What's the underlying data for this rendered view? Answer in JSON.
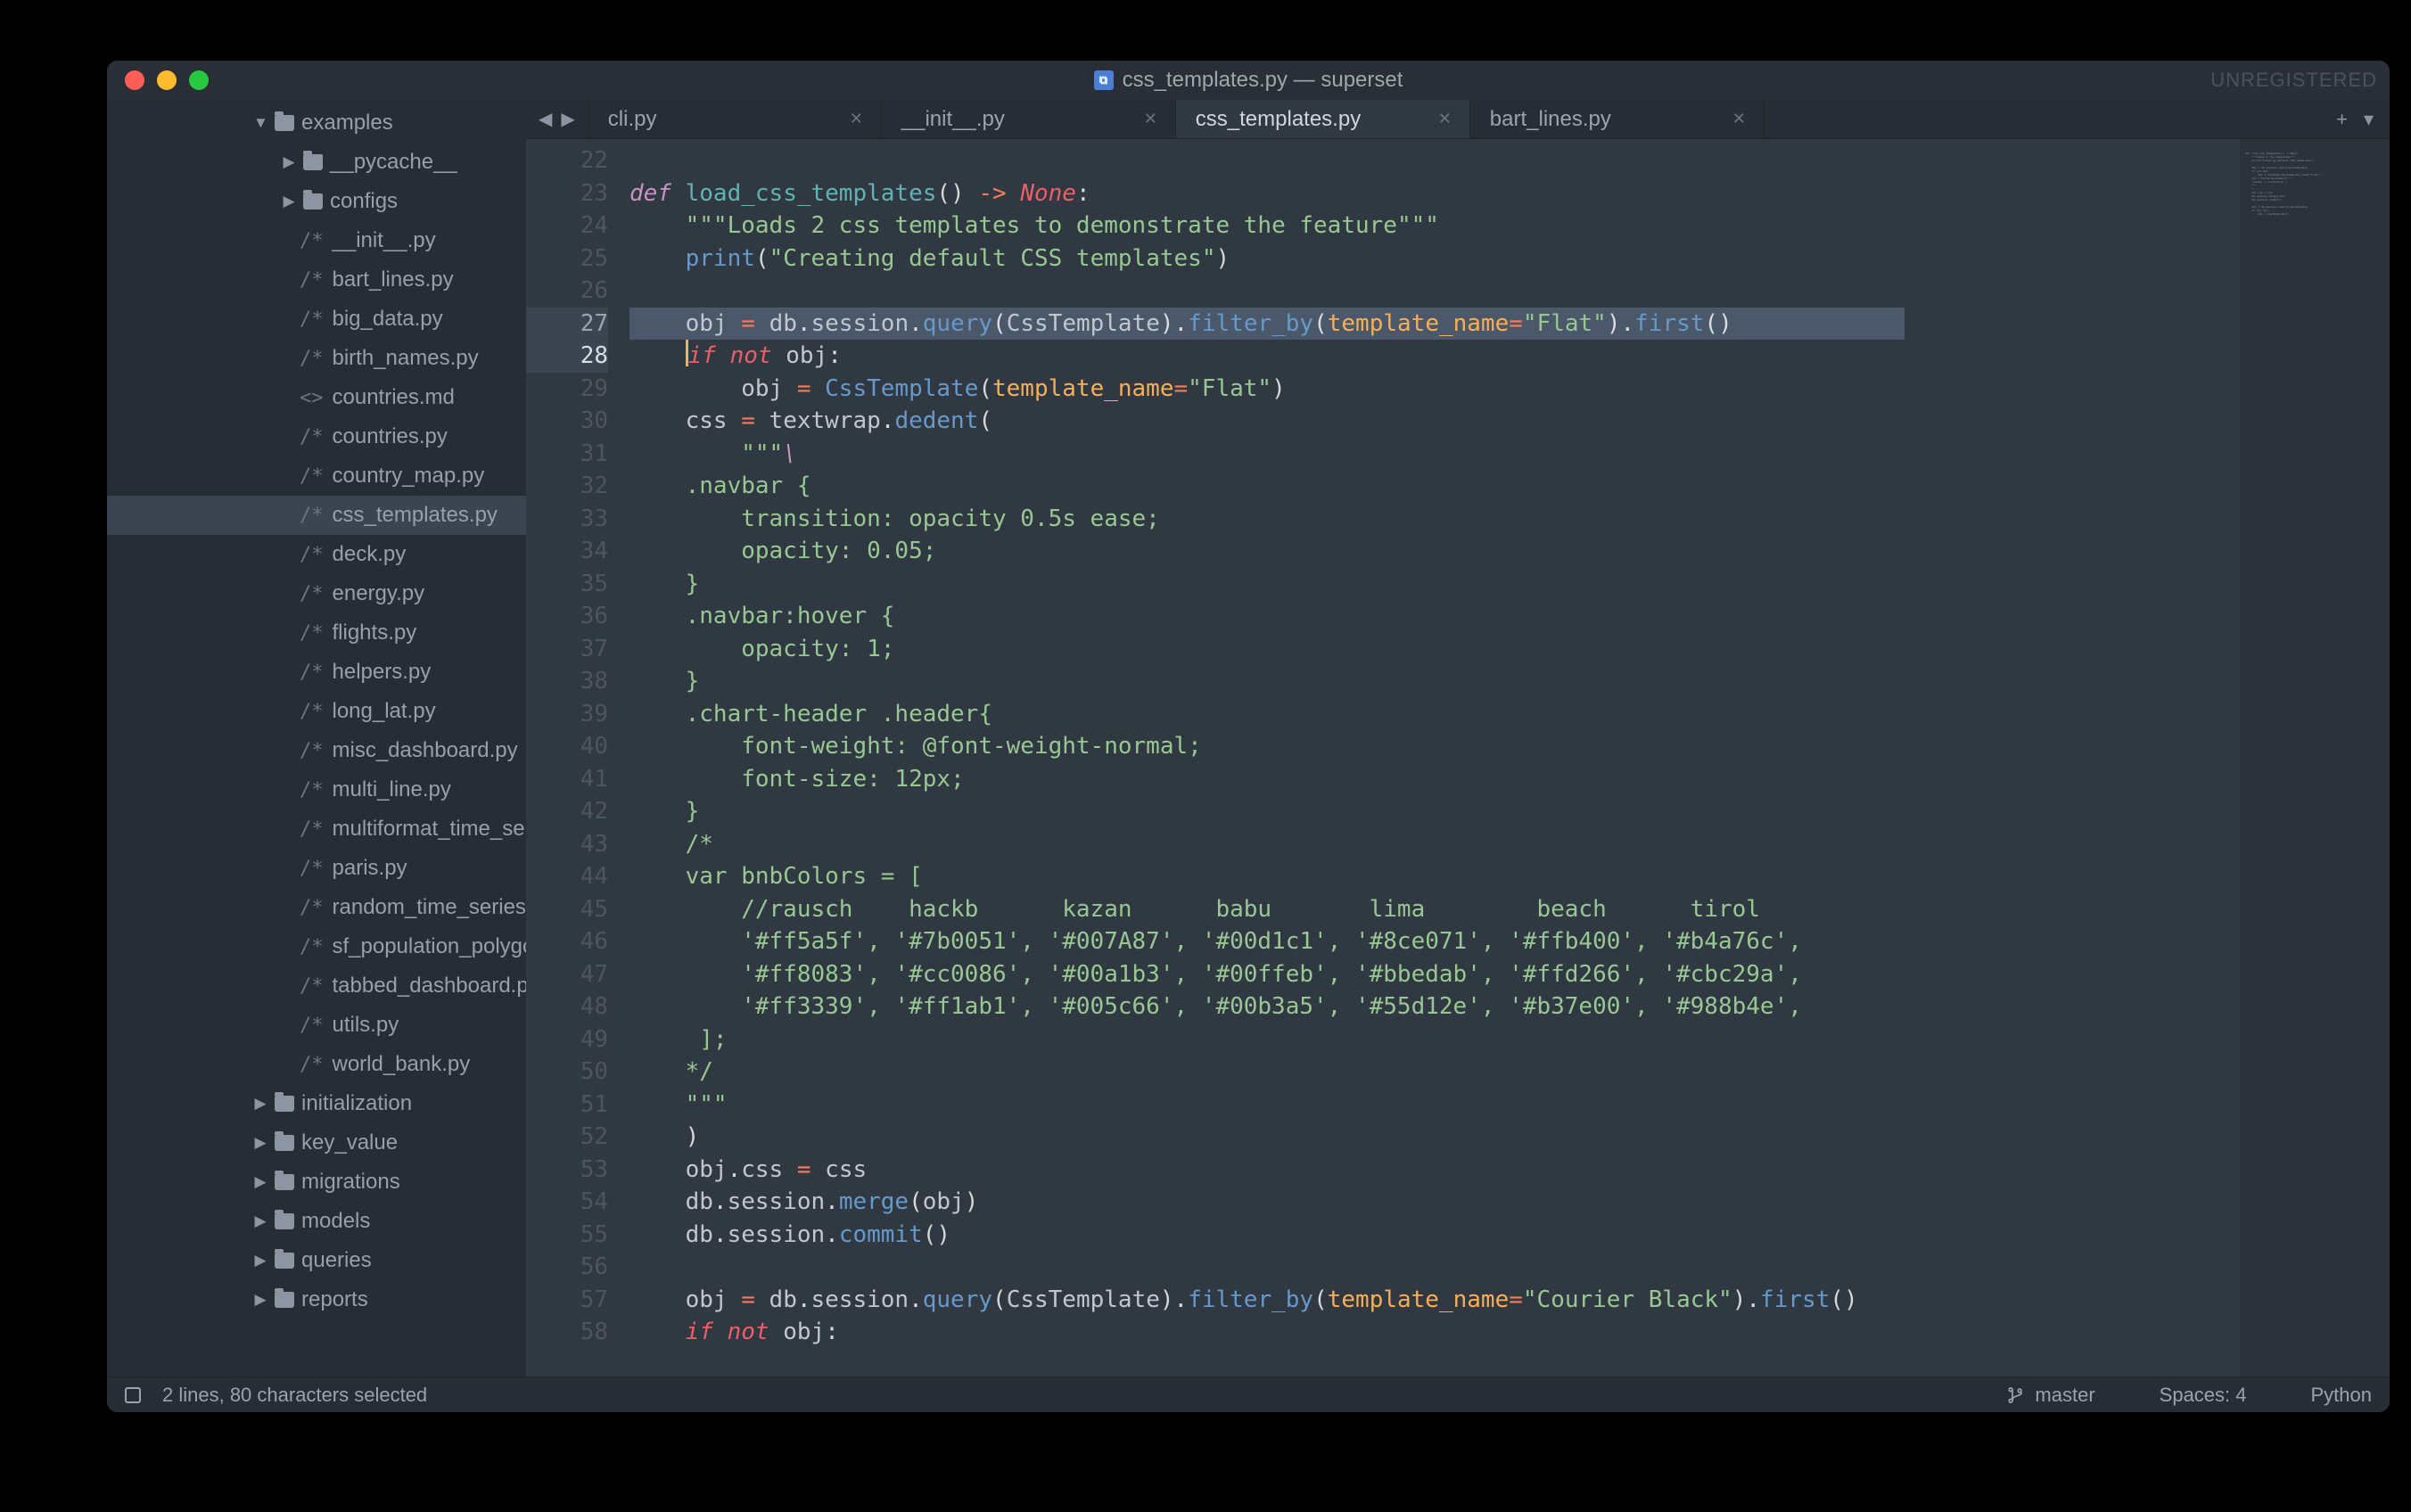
{
  "window": {
    "title_file": "css_templates.py",
    "title_project": "superset",
    "unregistered": "UNREGISTERED"
  },
  "traffic": {
    "close": "close",
    "min": "minimize",
    "max": "maximize"
  },
  "sidebar": {
    "root": "examples",
    "folders_top": [
      "__pycache__",
      "configs"
    ],
    "files": [
      "__init__.py",
      "bart_lines.py",
      "big_data.py",
      "birth_names.py",
      "countries.md",
      "countries.py",
      "country_map.py",
      "css_templates.py",
      "deck.py",
      "energy.py",
      "flights.py",
      "helpers.py",
      "long_lat.py",
      "misc_dashboard.py",
      "multi_line.py",
      "multiformat_time_series.py",
      "paris.py",
      "random_time_series.py",
      "sf_population_polygons.py",
      "tabbed_dashboard.py",
      "utils.py",
      "world_bank.py"
    ],
    "active_file": "css_templates.py",
    "md_file": "countries.md",
    "folders_bottom": [
      "initialization",
      "key_value",
      "migrations",
      "models",
      "queries",
      "reports"
    ]
  },
  "tabs": [
    {
      "label": "cli.py"
    },
    {
      "label": "__init__.py"
    },
    {
      "label": "css_templates.py"
    },
    {
      "label": "bart_lines.py"
    }
  ],
  "active_tab": 2,
  "gutter": [
    "22",
    "23",
    "24",
    "25",
    "26",
    "27",
    "28",
    "29",
    "30",
    "31",
    "32",
    "33",
    "34",
    "35",
    "36",
    "37",
    "38",
    "39",
    "40",
    "41",
    "42",
    "43",
    "44",
    "45",
    "46",
    "47",
    "48",
    "49",
    "50",
    "51",
    "52",
    "53",
    "54",
    "55",
    "56",
    "57",
    "58"
  ],
  "gutter_selected": [
    5
  ],
  "gutter_current": 6,
  "code_tokens": {
    "def": "def",
    "fn": "load_css_templates",
    "arrow": "->",
    "none": "None",
    "doc": "\"\"\"Loads 2 css templates to demonstrate the feature\"\"\"",
    "print": "print",
    "printstr": "\"Creating default CSS templates\"",
    "obj": "obj",
    "db": "db",
    "session": "session",
    "query": "query",
    "CssTemplate": "CssTemplate",
    "filter_by": "filter_by",
    "template_name": "template_name",
    "flat": "\"Flat\"",
    "first": "first",
    "if": "if",
    "not": "not",
    "css": "css",
    "textwrap": "textwrap",
    "dedent": "dedent",
    "triple": "\"\"\"",
    "bs": "\\",
    "l32": ".navbar {",
    "l33": "    transition: opacity 0.5s ease;",
    "l34": "    opacity: 0.05;",
    "l35": "}",
    "l36": ".navbar:hover {",
    "l37": "    opacity: 1;",
    "l38": "}",
    "l39": ".chart-header .header{",
    "l40": "    font-weight: @font-weight-normal;",
    "l41": "    font-size: 12px;",
    "l42": "}",
    "l43": "/*",
    "l44": "var bnbColors = [",
    "l45": "    //rausch    hackb      kazan      babu       lima        beach      tirol",
    "l46": "    '#ff5a5f', '#7b0051', '#007A87', '#00d1c1', '#8ce071', '#ffb400', '#b4a76c',",
    "l47": "    '#ff8083', '#cc0086', '#00a1b3', '#00ffeb', '#bbedab', '#ffd266', '#cbc29a',",
    "l48": "    '#ff3339', '#ff1ab1', '#005c66', '#00b3a5', '#55d12e', '#b37e00', '#988b4e',",
    "l49": " ];",
    "l50": "*/",
    "l51": "\"\"\"",
    "merge": "merge",
    "commit": "commit",
    "courier": "\"Courier Black\""
  },
  "status": {
    "selection": "2 lines, 80 characters selected",
    "branch": "master",
    "spaces": "Spaces: 4",
    "lang": "Python"
  }
}
